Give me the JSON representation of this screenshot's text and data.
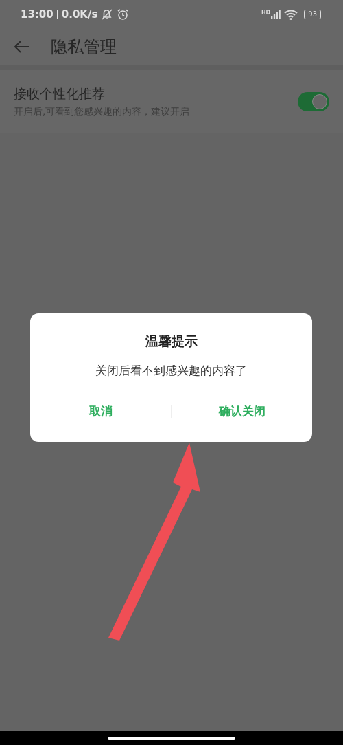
{
  "status_bar": {
    "time": "13:00",
    "speed": "0.0K/s",
    "network": "HD",
    "battery": "93"
  },
  "header": {
    "title": "隐私管理"
  },
  "setting": {
    "title": "接收个性化推荐",
    "subtitle": "开启后,可看到您感兴趣的内容，建议开启",
    "on": true
  },
  "dialog": {
    "title": "温馨提示",
    "message": "关闭后看不到感兴趣的内容了",
    "buttons": [
      "取消",
      "确认关闭"
    ]
  }
}
